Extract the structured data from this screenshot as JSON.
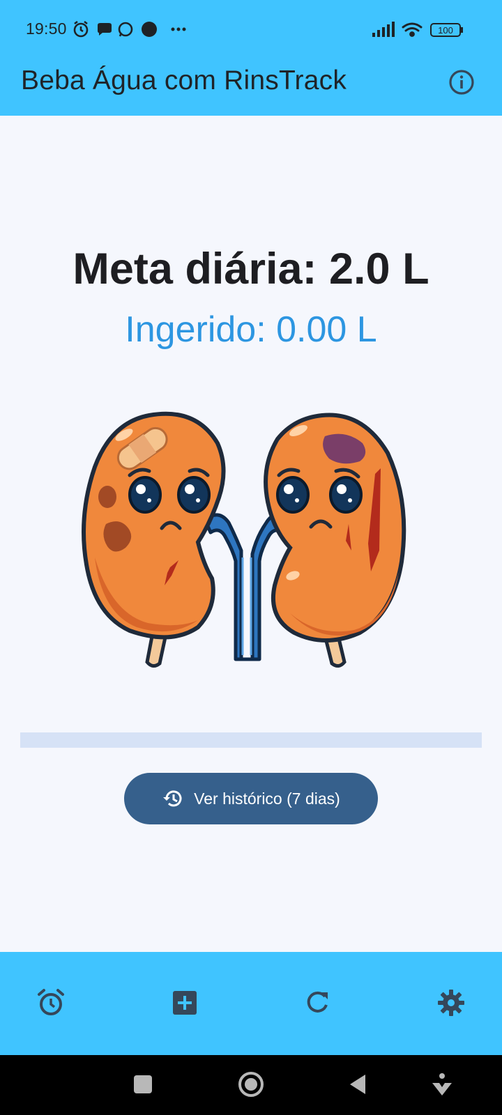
{
  "status_bar": {
    "time": "19:50",
    "left_icons": [
      "alarm-icon",
      "chat-bubble-icon",
      "whatsapp-icon",
      "dot-icon",
      "more-dots-icon"
    ],
    "right_icons": [
      "signal-icon",
      "wifi-icon",
      "battery-icon"
    ],
    "battery": "100"
  },
  "app_bar": {
    "title": "Beba Água com RinsTrack",
    "action_icon": "info-icon"
  },
  "main": {
    "goal_text": "Meta diária: 2.0 L",
    "intake_text": "Ingerido: 0.00 L",
    "mascot": "sad-kidneys-illustration",
    "progress": 0,
    "history_button": {
      "label": "Ver histórico (7 dias)",
      "icon": "history-icon"
    }
  },
  "bottom_nav": {
    "items": [
      {
        "icon": "alarm-icon"
      },
      {
        "icon": "add-box-icon"
      },
      {
        "icon": "refresh-icon"
      },
      {
        "icon": "settings-icon"
      }
    ]
  },
  "system_nav": {
    "items": [
      "recents-icon",
      "home-icon",
      "back-icon",
      "accessibility-icon"
    ]
  },
  "colors": {
    "accent": "#40c4ff",
    "background": "#f5f7fd",
    "intake_text": "#2d96e1",
    "button": "#36608c",
    "progress_track": "#d6e2f6",
    "icon": "#35475a"
  }
}
